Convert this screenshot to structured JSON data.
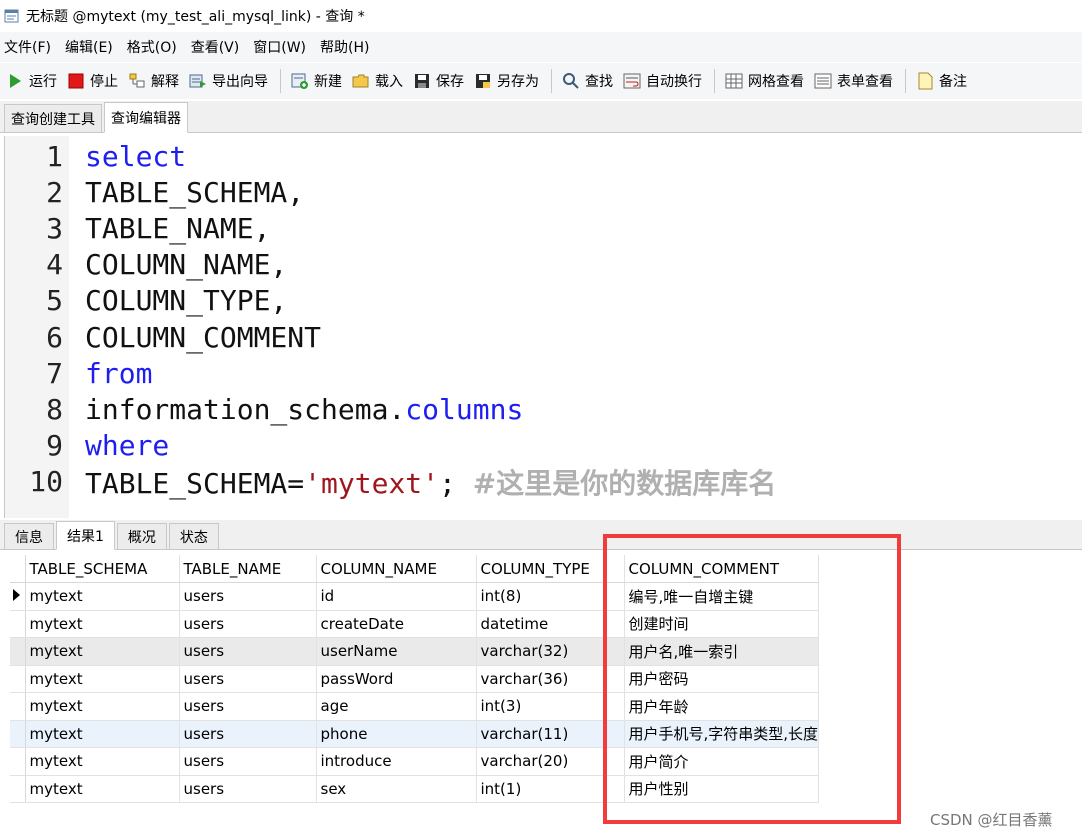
{
  "window": {
    "title": "无标题 @mytext (my_test_ali_mysql_link) - 查询 *"
  },
  "menu": [
    "文件(F)",
    "编辑(E)",
    "格式(O)",
    "查看(V)",
    "窗口(W)",
    "帮助(H)"
  ],
  "toolbar": {
    "run": "运行",
    "stop": "停止",
    "explain": "解释",
    "export_wizard": "导出向导",
    "new": "新建",
    "load": "载入",
    "save": "保存",
    "save_as": "另存为",
    "find": "查找",
    "word_wrap": "自动换行",
    "grid_view": "网格查看",
    "form_view": "表单查看",
    "note": "备注"
  },
  "top_tabs": [
    "查询创建工具",
    "查询编辑器"
  ],
  "editor": {
    "lines": [
      {
        "no": "1",
        "pre": "",
        "kw": "select",
        "post": "",
        "str": "",
        "cmt": ""
      },
      {
        "no": "2",
        "pre": "TABLE_SCHEMA,",
        "kw": "",
        "post": "",
        "str": "",
        "cmt": ""
      },
      {
        "no": "3",
        "pre": "TABLE_NAME,",
        "kw": "",
        "post": "",
        "str": "",
        "cmt": ""
      },
      {
        "no": "4",
        "pre": "COLUMN_NAME,",
        "kw": "",
        "post": "",
        "str": "",
        "cmt": ""
      },
      {
        "no": "5",
        "pre": "COLUMN_TYPE,",
        "kw": "",
        "post": "",
        "str": "",
        "cmt": ""
      },
      {
        "no": "6",
        "pre": "COLUMN_COMMENT",
        "kw": "",
        "post": "",
        "str": "",
        "cmt": ""
      },
      {
        "no": "7",
        "pre": "",
        "kw": "from",
        "post": "",
        "str": "",
        "cmt": ""
      },
      {
        "no": "8",
        "pre": "information_schema.",
        "kw": "columns",
        "post": "",
        "str": "",
        "cmt": ""
      },
      {
        "no": "9",
        "pre": "",
        "kw": "where",
        "post": "",
        "str": "",
        "cmt": ""
      },
      {
        "no": "10",
        "pre": "TABLE_SCHEMA=",
        "kw": "",
        "str": "'mytext'",
        "post": "; ",
        "cmt": "#这里是你的数据库库名"
      }
    ]
  },
  "bottom_tabs": [
    "信息",
    "结果1",
    "概况",
    "状态"
  ],
  "grid": {
    "columns": [
      "TABLE_SCHEMA",
      "TABLE_NAME",
      "COLUMN_NAME",
      "COLUMN_TYPE",
      "COLUMN_COMMENT"
    ],
    "rows": [
      [
        "mytext",
        "users",
        "id",
        "int(8)",
        "编号,唯一自增主键"
      ],
      [
        "mytext",
        "users",
        "createDate",
        "datetime",
        "创建时间"
      ],
      [
        "mytext",
        "users",
        "userName",
        "varchar(32)",
        "用户名,唯一索引"
      ],
      [
        "mytext",
        "users",
        "passWord",
        "varchar(36)",
        "用户密码"
      ],
      [
        "mytext",
        "users",
        "age",
        "int(3)",
        "用户年龄"
      ],
      [
        "mytext",
        "users",
        "phone",
        "varchar(11)",
        "用户手机号,字符串类型,长度"
      ],
      [
        "mytext",
        "users",
        "introduce",
        "varchar(20)",
        "用户简介"
      ],
      [
        "mytext",
        "users",
        "sex",
        "int(1)",
        "用户性别"
      ]
    ]
  },
  "watermark": "CSDN @红目香薰"
}
